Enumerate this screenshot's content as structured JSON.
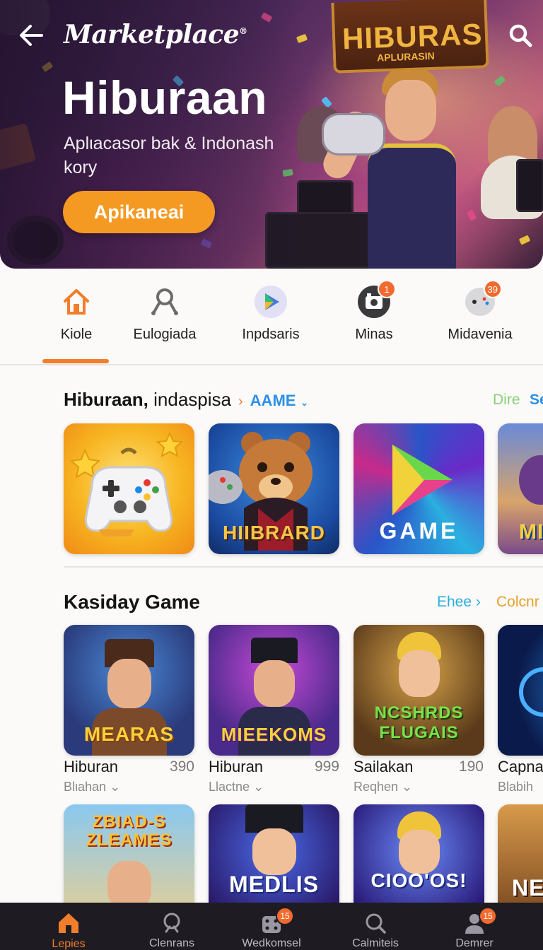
{
  "header": {
    "brand": "Marketplace",
    "brand_mark": "®",
    "back_icon": "arrow-left-icon",
    "search_icon": "search-icon"
  },
  "hero": {
    "title": "Hiburaan",
    "subtitle": "Aplιacasor bak & Indonash kory",
    "cta_label": "Apikaneai",
    "sign_title": "HIBURAS",
    "sign_top": "HIBURAS",
    "sign_sub": "APLURASIN"
  },
  "categories": [
    {
      "label": "Kiole",
      "icon": "home-icon",
      "badge": ""
    },
    {
      "label": "Eulogiada",
      "icon": "controller-icon",
      "badge": ""
    },
    {
      "label": "Inpdsaris",
      "icon": "play-store-icon",
      "badge": ""
    },
    {
      "label": "Minas",
      "icon": "camera-icon",
      "badge": "1"
    },
    {
      "label": "Midavenia",
      "icon": "gamepad-icon",
      "badge": "39"
    }
  ],
  "section1": {
    "title_bold": "Hiburaan,",
    "title_rest": " indaspisa",
    "filter": "AAME",
    "link1": "Dire",
    "link2": "Se",
    "tiles": [
      {
        "caption": "",
        "art": "gamepad-stars"
      },
      {
        "caption": "HIIBRARD",
        "art": "bear-mascot"
      },
      {
        "caption": "GAME",
        "art": "play-logo"
      },
      {
        "caption": "MI",
        "art": "fantasy-heroes"
      }
    ]
  },
  "section2": {
    "title": "Kasiday Game",
    "link1": "Ehee",
    "link2": "Colcnr",
    "games": [
      {
        "caption": "MEARAS",
        "name": "Hiburan",
        "count": "390",
        "sub": "Blιahan"
      },
      {
        "caption": "MIEEKOMS",
        "name": "Hiburan",
        "count": "999",
        "sub": "Llactne"
      },
      {
        "caption": "NCSHRDS FLUGAIS",
        "name": "Sailakan",
        "count": "190",
        "sub": "Reqhen"
      },
      {
        "caption": "",
        "name": "Capna",
        "count": "",
        "sub": "Blabih"
      }
    ],
    "row2": [
      {
        "caption": "ZBIAD-S ZLEAMES"
      },
      {
        "caption": "MEDLIS"
      },
      {
        "caption": "CIOO'OS!"
      },
      {
        "caption": "NE"
      }
    ]
  },
  "bottom_nav": [
    {
      "label": "Lepies",
      "icon": "home-icon",
      "badge": ""
    },
    {
      "label": "Clenrans",
      "icon": "search-icon",
      "badge": ""
    },
    {
      "label": "Wedkomsel",
      "icon": "dice-icon",
      "badge": "15"
    },
    {
      "label": "Calmiteis",
      "icon": "magnifier-icon",
      "badge": ""
    },
    {
      "label": "Demrer",
      "icon": "user-icon",
      "badge": "15"
    }
  ],
  "colors": {
    "accent": "#f07e2b",
    "link_blue": "#2c90e8",
    "link_green": "#8ad07a",
    "link_gold": "#e6a12b",
    "nav_bg": "#1e1c22"
  }
}
